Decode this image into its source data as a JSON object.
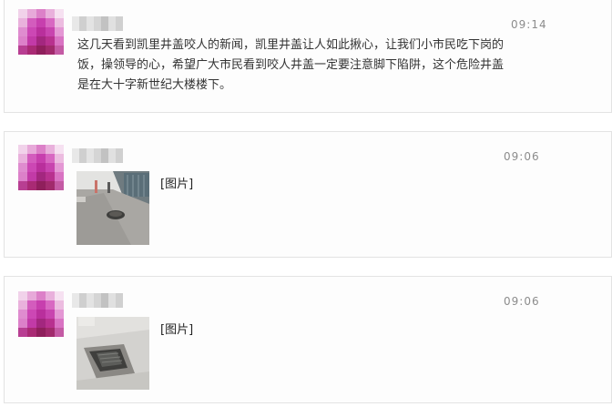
{
  "colors": {
    "card_border": "#e3e3e3",
    "timestamp": "#8c8c8c",
    "text": "#333333",
    "avatar_magenta": "#c83ea8"
  },
  "messages": [
    {
      "time": "09:14",
      "avatar_icon": "blurred-avatar",
      "text": "这几天看到凯里井盖咬人的新闻，凯里井盖让人如此揪心，让我们小市民吃下岗的饭，操领导的心，希望广大市民看到咬人井盖一定要注意脚下陷阱，这个危险井盖是在大十字新世纪大楼楼下。"
    },
    {
      "time": "09:06",
      "avatar_icon": "blurred-avatar",
      "image_label": "[图片]",
      "thumbnail_icon": "street-manhole-photo"
    },
    {
      "time": "09:06",
      "avatar_icon": "blurred-avatar",
      "image_label": "[图片]",
      "thumbnail_icon": "open-manhole-photo"
    }
  ]
}
